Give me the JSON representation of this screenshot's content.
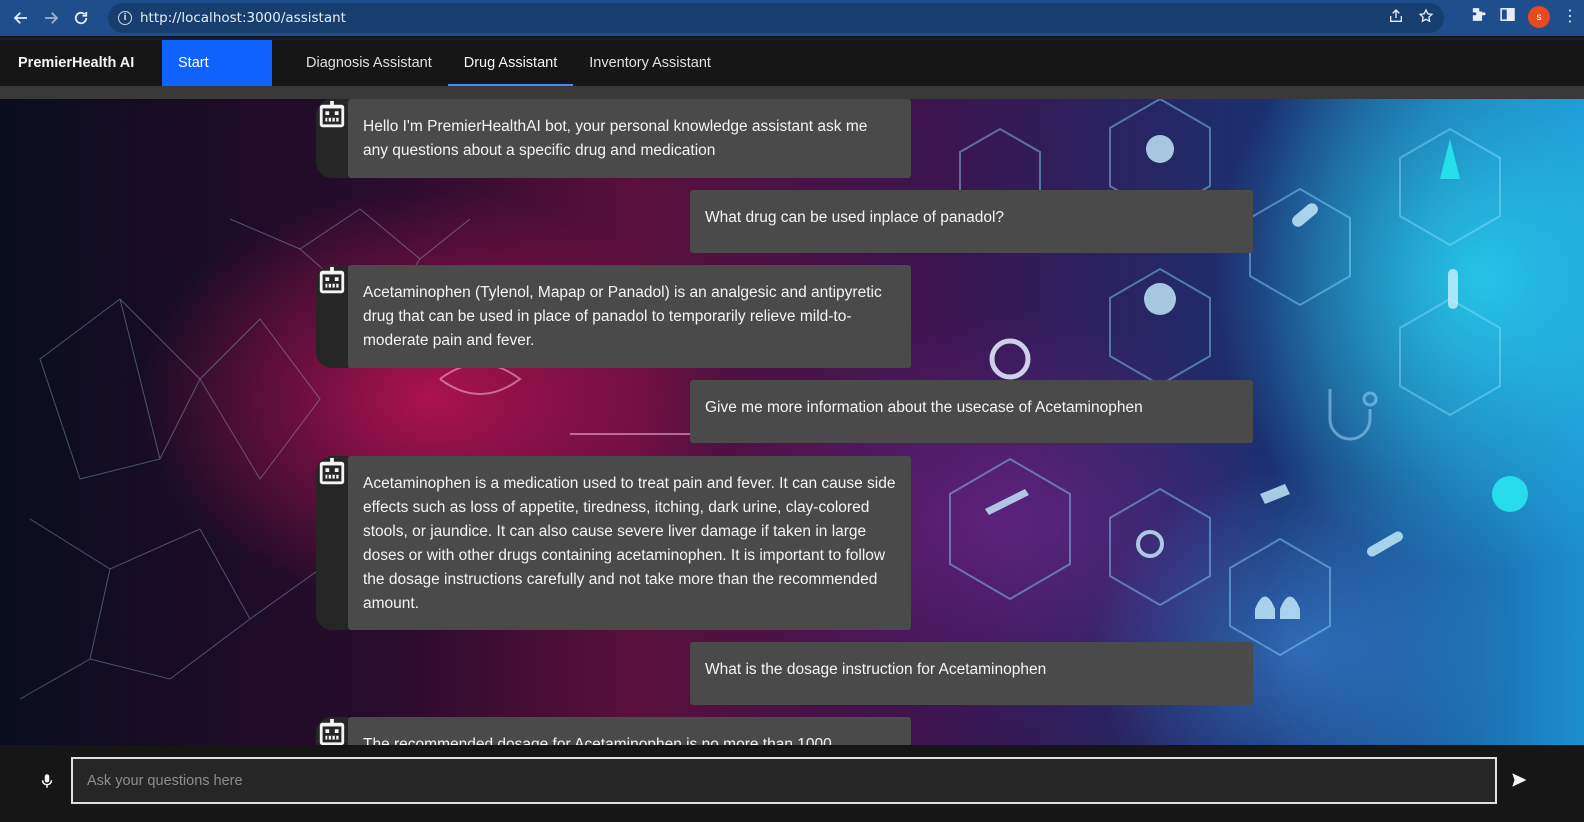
{
  "browser": {
    "url": "http://localhost:3000/assistant",
    "profile_initial": "s",
    "icons": [
      "back-icon",
      "forward-icon",
      "reload-icon",
      "info-icon",
      "share-icon",
      "star-icon",
      "extensions-icon",
      "sidepanel-icon",
      "kebab-menu-icon"
    ]
  },
  "header": {
    "brand": "PremierHealth AI",
    "start_label": "Start",
    "tabs": [
      {
        "label": "Diagnosis Assistant",
        "active": false
      },
      {
        "label": "Drug Assistant",
        "active": true
      },
      {
        "label": "Inventory Assistant",
        "active": false
      }
    ]
  },
  "chat": {
    "messages": [
      {
        "role": "bot",
        "text": "Hello I'm PremierHealthAI bot, your personal knowledge assistant ask me any questions about a specific drug and medication"
      },
      {
        "role": "user",
        "text": "What drug can be used inplace of panadol?"
      },
      {
        "role": "bot",
        "text": "Acetaminophen (Tylenol, Mapap or Panadol) is an analgesic and antipyretic drug that can be used in place of panadol to temporarily relieve mild-to-moderate pain and fever."
      },
      {
        "role": "user",
        "text": "Give me more information about the usecase of Acetaminophen"
      },
      {
        "role": "bot",
        "text": "Acetaminophen is a medication used to treat pain and fever. It can cause side effects such as loss of appetite, tiredness, itching, dark urine, clay-colored stools, or jaundice. It can also cause severe liver damage if taken in large doses or with other drugs containing acetaminophen. It is important to follow the dosage instructions carefully and not take more than the recommended amount."
      },
      {
        "role": "user",
        "text": "What is the dosage instruction for Acetaminophen"
      },
      {
        "role": "bot",
        "text": "The recommended dosage for Acetaminophen is no more than 1000"
      }
    ]
  },
  "composer": {
    "placeholder": "Ask your questions here",
    "value": ""
  },
  "colors": {
    "accent": "#0f62fe",
    "tab_underline": "#4589ff",
    "bubble": "#4a4a4a",
    "chrome": "#1e4f8c"
  }
}
